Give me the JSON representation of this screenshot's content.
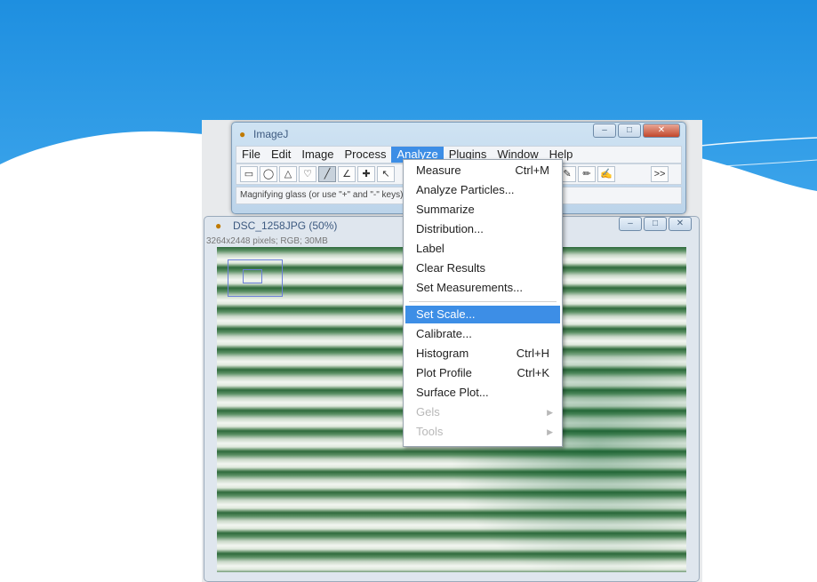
{
  "colors": {
    "slide_top": "#1e8fe0",
    "menu_highlight": "#3d8ee6"
  },
  "imagej": {
    "title": "ImageJ",
    "menu": [
      "File",
      "Edit",
      "Image",
      "Process",
      "Analyze",
      "Plugins",
      "Window",
      "Help"
    ],
    "active_menu": "Analyze",
    "status": "Magnifying glass (or use \"+\" and \"-\" keys)",
    "more_tools": ">>"
  },
  "image_window": {
    "title": "DSC_1258JPG (50%)",
    "info": "3264x2448 pixels; RGB; 30MB"
  },
  "analyze_menu": {
    "items": [
      {
        "label": "Measure",
        "shortcut": "Ctrl+M",
        "state": "normal"
      },
      {
        "label": "Analyze Particles...",
        "shortcut": "",
        "state": "normal"
      },
      {
        "label": "Summarize",
        "shortcut": "",
        "state": "normal"
      },
      {
        "label": "Distribution...",
        "shortcut": "",
        "state": "normal"
      },
      {
        "label": "Label",
        "shortcut": "",
        "state": "normal"
      },
      {
        "label": "Clear Results",
        "shortcut": "",
        "state": "normal"
      },
      {
        "label": "Set Measurements...",
        "shortcut": "",
        "state": "normal"
      },
      {
        "label": "Set Scale...",
        "shortcut": "",
        "state": "highlighted"
      },
      {
        "label": "Calibrate...",
        "shortcut": "",
        "state": "normal"
      },
      {
        "label": "Histogram",
        "shortcut": "Ctrl+H",
        "state": "normal"
      },
      {
        "label": "Plot Profile",
        "shortcut": "Ctrl+K",
        "state": "normal"
      },
      {
        "label": "Surface Plot...",
        "shortcut": "",
        "state": "normal"
      },
      {
        "label": "Gels",
        "shortcut": "",
        "state": "disabled"
      },
      {
        "label": "Tools",
        "shortcut": "",
        "state": "disabled"
      }
    ]
  }
}
